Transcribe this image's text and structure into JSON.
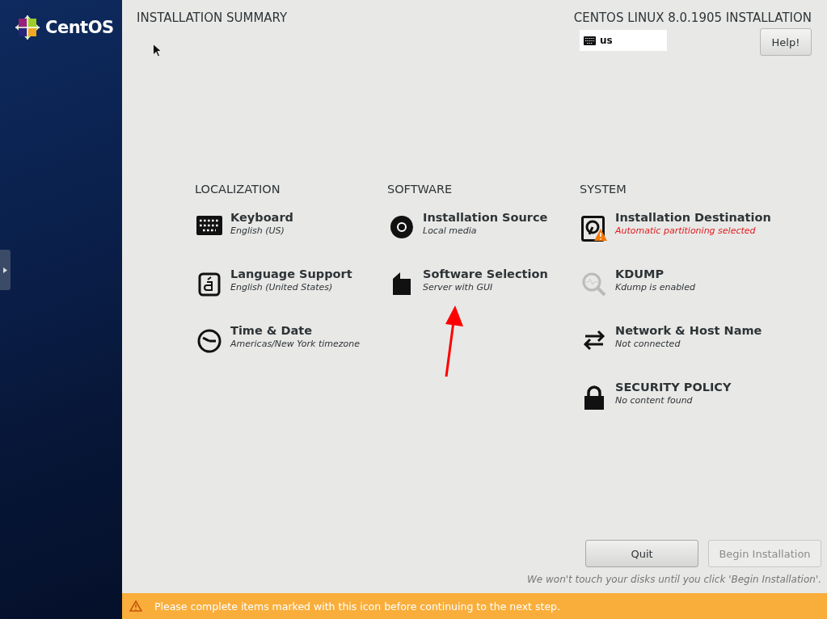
{
  "sidebar": {
    "logo_text": "CentOS"
  },
  "header": {
    "title": "INSTALLATION SUMMARY",
    "product": "CENTOS LINUX 8.0.1905 INSTALLATION",
    "keyboard_layout": "us",
    "help_button": "Help!"
  },
  "sections": [
    {
      "title": "LOCALIZATION",
      "items": [
        {
          "title": "Keyboard",
          "status": "English (US)",
          "warning": false
        },
        {
          "title": "Language Support",
          "status": "English (United States)",
          "warning": false
        },
        {
          "title": "Time & Date",
          "status": "Americas/New York timezone",
          "warning": false
        }
      ]
    },
    {
      "title": "SOFTWARE",
      "items": [
        {
          "title": "Installation Source",
          "status": "Local media",
          "warning": false
        },
        {
          "title": "Software Selection",
          "status": "Server with GUI",
          "warning": false
        }
      ]
    },
    {
      "title": "SYSTEM",
      "items": [
        {
          "title": "Installation Destination",
          "status": "Automatic partitioning selected",
          "warning": true
        },
        {
          "title": "KDUMP",
          "status": "Kdump is enabled",
          "warning": false
        },
        {
          "title": "Network & Host Name",
          "status": "Not connected",
          "warning": false
        },
        {
          "title": "SECURITY POLICY",
          "status": "No content found",
          "warning": false
        }
      ]
    }
  ],
  "buttons": [
    {
      "label": "Quit",
      "disabled": false
    },
    {
      "label": "Begin Installation",
      "disabled": true
    }
  ],
  "footer_note": "We won't touch your disks until you click 'Begin Installation'.",
  "warning_bar": {
    "message": "Please complete items marked with this icon before continuing to the next step."
  }
}
